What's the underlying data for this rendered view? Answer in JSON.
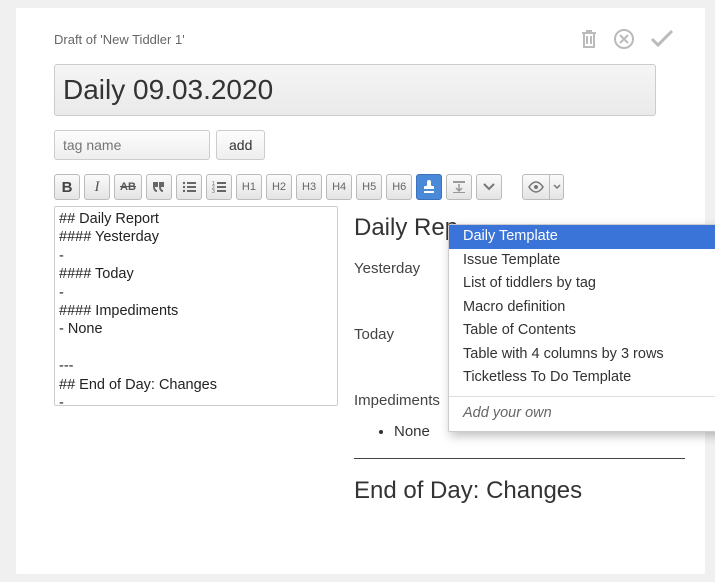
{
  "draft_label": "Draft of 'New Tiddler 1'",
  "title": "Daily 09.03.2020",
  "tag_placeholder": "tag name",
  "add_label": "add",
  "toolbar": {
    "bold": "B",
    "italic": "I",
    "strike": "AB",
    "quote": "❝",
    "ul": "≣",
    "ol": "≣",
    "h1": "H1",
    "h2": "H2",
    "h3": "H3",
    "h4": "H4",
    "h5": "H5",
    "h6": "H6"
  },
  "source_text": "## Daily Report\n#### Yesterday\n-\n#### Today\n-\n#### Impediments\n- None\n\n---\n## End of Day: Changes\n-",
  "preview": {
    "title": "Daily Rep",
    "yesterday": "Yesterday",
    "today": "Today",
    "impediments": "Impediments",
    "impediments_item": "None",
    "eod": "End of Day: Changes"
  },
  "dropdown": {
    "items": [
      "Daily Template",
      "Issue Template",
      "List of tiddlers by tag",
      "Macro definition",
      "Table of Contents",
      "Table with 4 columns by 3 rows",
      "Ticketless To Do Template"
    ],
    "add_your_own": "Add your own"
  }
}
